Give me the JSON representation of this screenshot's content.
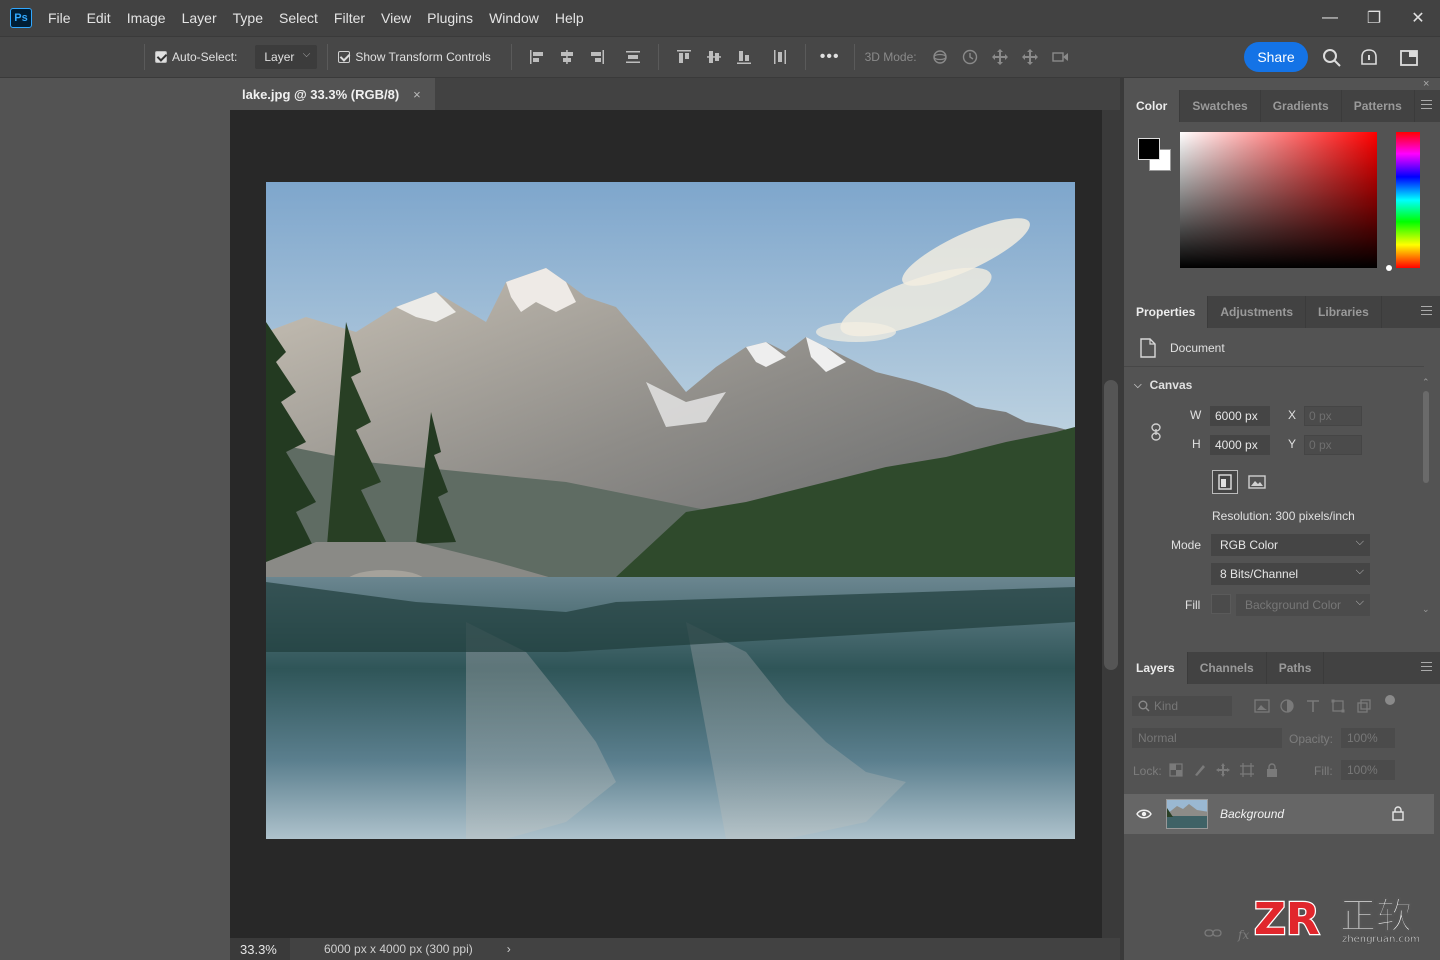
{
  "app": {
    "logo": "Ps"
  },
  "menu": [
    "File",
    "Edit",
    "Image",
    "Layer",
    "Type",
    "Select",
    "Filter",
    "View",
    "Plugins",
    "Window",
    "Help"
  ],
  "window_controls": {
    "minimize": "—",
    "maximize": "❐",
    "close": "✕"
  },
  "options_bar": {
    "auto_select_label": "Auto-Select:",
    "auto_select_checked": true,
    "layer_select_value": "Layer",
    "show_transform_label": "Show Transform Controls",
    "show_transform_checked": true,
    "more_label": "•••",
    "mode_3d_label": "3D Mode:",
    "share_label": "Share",
    "accent_color": "#1473e6"
  },
  "document": {
    "tab_title": "lake.jpg @ 33.3% (RGB/8)",
    "tab_close": "×",
    "zoom": "33.3%",
    "info": "6000 px x 4000 px (300 ppi)",
    "status_arrow": "›"
  },
  "panel_close": "×",
  "color_panel": {
    "tabs": [
      "Color",
      "Swatches",
      "Gradients",
      "Patterns"
    ],
    "active_tab": "Color",
    "foreground": "#000000",
    "background": "#ffffff",
    "hue_color": "#ff0000"
  },
  "properties_panel": {
    "tabs": [
      "Properties",
      "Adjustments",
      "Libraries"
    ],
    "active_tab": "Properties",
    "document_label": "Document",
    "canvas_section": "Canvas",
    "w_label": "W",
    "w_value": "6000 px",
    "h_label": "H",
    "h_value": "4000 px",
    "x_label": "X",
    "x_placeholder": "0 px",
    "y_label": "Y",
    "y_placeholder": "0 px",
    "resolution": "Resolution: 300 pixels/inch",
    "mode_label": "Mode",
    "mode_value": "RGB Color",
    "bits_value": "8 Bits/Channel",
    "fill_label": "Fill",
    "fill_value": "Background Color"
  },
  "layers_panel": {
    "tabs": [
      "Layers",
      "Channels",
      "Paths"
    ],
    "active_tab": "Layers",
    "kind_label": "Kind",
    "blend_mode": "Normal",
    "opacity_label": "Opacity:",
    "opacity_value": "100%",
    "lock_label": "Lock:",
    "fill_label": "Fill:",
    "fill_value": "100%",
    "layers": [
      {
        "name": "Background",
        "visible": true,
        "locked": true
      }
    ],
    "footer_icons": [
      "link-icon",
      "fx-icon"
    ],
    "fx_label": "fx"
  },
  "watermark": {
    "logo": "ZR",
    "cn_text": "正软",
    "url": "zhengruan.com"
  }
}
